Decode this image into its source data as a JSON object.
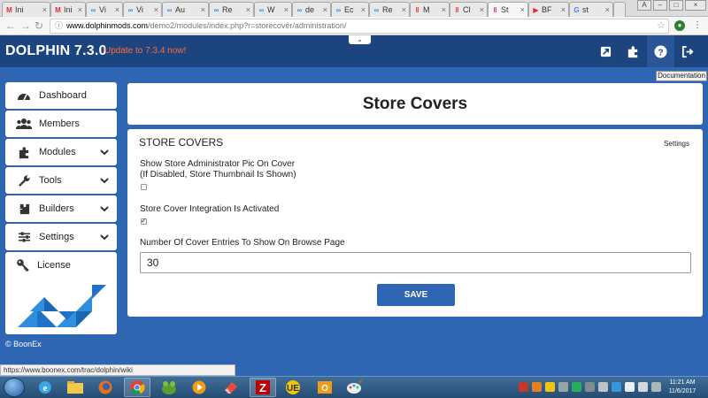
{
  "browser": {
    "tabs": [
      {
        "icon": "gmail-icon",
        "label": "Ini"
      },
      {
        "icon": "gmail-icon",
        "label": "Ini"
      },
      {
        "icon": "link-icon",
        "label": "Vi"
      },
      {
        "icon": "link-icon",
        "label": "Vi"
      },
      {
        "icon": "link-icon",
        "label": "Au"
      },
      {
        "icon": "link-icon",
        "label": "Re"
      },
      {
        "icon": "link-icon",
        "label": "W"
      },
      {
        "icon": "link-icon",
        "label": "de"
      },
      {
        "icon": "link-icon",
        "label": "Ec"
      },
      {
        "icon": "link-icon",
        "label": "Re"
      },
      {
        "icon": "pause-icon",
        "label": "M"
      },
      {
        "icon": "pause-icon",
        "label": "Cl"
      },
      {
        "icon": "pause-icon",
        "label": "St"
      },
      {
        "icon": "youtube-icon",
        "label": "BF"
      },
      {
        "icon": "google-icon",
        "label": "st"
      }
    ],
    "url_host": "www.dolphinmods.com",
    "url_path": "/demo2/modules/index.php?r=storecover/administration/",
    "status_url": "https://www.boonex.com/trac/dolphin/wiki",
    "window_controls": [
      "A",
      "–",
      "□",
      "×"
    ]
  },
  "header": {
    "brand": "DOLPHIN 7.3.0",
    "update_notice": "Update to 7.3.4 now!",
    "tooltip": "Documentation",
    "dropdown_handle": "⌄"
  },
  "sidebar": {
    "items": [
      {
        "label": "Dashboard",
        "icon": "dashboard-icon",
        "has_submenu": false
      },
      {
        "label": "Members",
        "icon": "users-icon",
        "has_submenu": false
      },
      {
        "label": "Modules",
        "icon": "puzzle-icon",
        "has_submenu": true
      },
      {
        "label": "Tools",
        "icon": "wrench-icon",
        "has_submenu": true
      },
      {
        "label": "Builders",
        "icon": "puzzle-piece-icon",
        "has_submenu": true
      },
      {
        "label": "Settings",
        "icon": "sliders-icon",
        "has_submenu": true
      }
    ],
    "license_label": "License",
    "copyright": "© BoonEx"
  },
  "main": {
    "title": "Store Covers",
    "section_title": "STORE COVERS",
    "settings_link": "Settings",
    "fields": {
      "show_admin_pic_label_1": "Show Store Administrator Pic On Cover",
      "show_admin_pic_label_2": "(If Disabled, Store Thumbnail Is Shown)",
      "show_admin_pic_checked": false,
      "integration_label": "Store Cover Integration Is Activated",
      "integration_checked": true,
      "entries_label": "Number Of Cover Entries To Show On Browse Page",
      "entries_value": "30"
    },
    "save_label": "SAVE"
  },
  "taskbar": {
    "clock_time": "11:21 AM",
    "clock_date": "11/6/2017"
  },
  "colors": {
    "page_bg": "#2f66b3",
    "header_bg": "#1c4580",
    "update_text": "#ff6a3d",
    "save_button": "#2f66b3"
  }
}
